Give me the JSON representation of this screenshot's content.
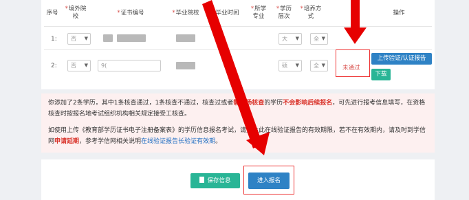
{
  "table": {
    "headers": {
      "index": "序号",
      "overseas": "境外院校",
      "cert_no": "证书编号",
      "school": "毕业院校",
      "grad_time": "毕业时间",
      "major": "所学专业",
      "level": "学历层次",
      "mode": "培养方式",
      "operation": "操作"
    },
    "rows": [
      {
        "index": "1:",
        "overseas": "否",
        "level": "大",
        "mode": "全"
      },
      {
        "index": "2:",
        "overseas": "否",
        "cert_prefix": "9(",
        "level": "硕",
        "mode": "全",
        "status": "未通过"
      }
    ],
    "buttons": {
      "upload": "上传验证/认证报告",
      "download": "下载"
    }
  },
  "notice": {
    "p1": {
      "a": "你添加了2条学历，其中1条核查通过，1条核查不通过，核查",
      "b": "过或者",
      "c": "需现场核查",
      "d": "的学历",
      "e": "不会影响后续报名",
      "f": "，可先进行报考信息填写，在资格核查时按报名地考试组织机构相关规定接受",
      "g": "工核查。"
    },
    "p2": {
      "a": "如使用上传《教育部学历证书电子注册备案表》的学历信息报名",
      "b": "考试，请关注此在线验证报告的有效期限，若不在有效期内，请及时到学信网",
      "c": "申请延期",
      "d": "，参考学信网相关说明",
      "e": "在线验证报告",
      "f": "长验证有效期",
      "g": "。"
    }
  },
  "actions": {
    "save": "保存信息",
    "enter": "进入报名"
  },
  "colors": {
    "arrow": "#e60000",
    "primary": "#2e82c5",
    "success": "#29b596",
    "danger": "#d9534f"
  }
}
